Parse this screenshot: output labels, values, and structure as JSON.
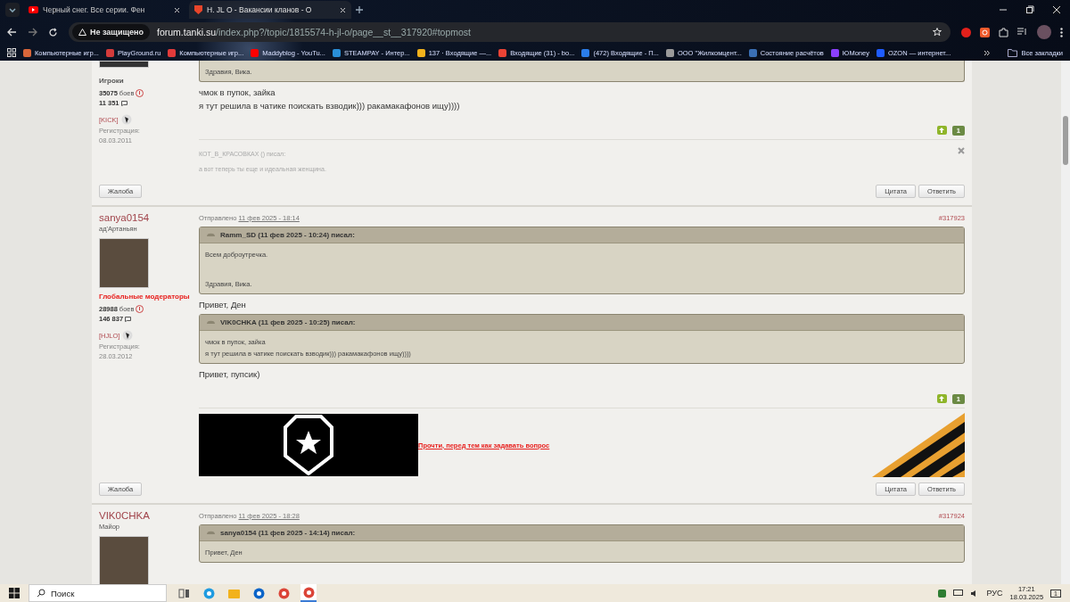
{
  "browser": {
    "tabs": [
      {
        "title": "Черный снег. Все серии. Фен",
        "selected": false,
        "kind": "video"
      },
      {
        "title": "H. JL O - Вакансии кланов - О",
        "selected": true,
        "kind": "shield"
      }
    ],
    "address": {
      "security": "Не защищено",
      "host": "forum.tanki.su",
      "path": "/index.php?/topic/1815574-h-jl-o/page__st__317920#topmost"
    },
    "bookmarks": [
      {
        "title": "Компьютерные игр...",
        "color": "#d9663a"
      },
      {
        "title": "PlayGround.ru",
        "color": "#d43b3b"
      },
      {
        "title": "Компьютерные игр...",
        "color": "#e23a3a"
      },
      {
        "title": "Maddyblog - YouTu...",
        "color": "#ff0000"
      },
      {
        "title": "STEAMPAY - Интер...",
        "color": "#2a8fd8"
      },
      {
        "title": "137 · Входящие —...",
        "color": "#f2b21c"
      },
      {
        "title": "Входящие (31) - bo...",
        "color": "#ea4335"
      },
      {
        "title": "(472) Входящие - П...",
        "color": "#2b7de9"
      },
      {
        "title": "ООО \"Жилкомцент...",
        "color": "#9a9a9a"
      },
      {
        "title": "Состояние расчётов",
        "color": "#3a6fb5"
      },
      {
        "title": "ЮMoney",
        "color": "#8b3ffd"
      },
      {
        "title": "OZON — интернет...",
        "color": "#1f5cff"
      }
    ],
    "all_bookmarks": "Все закладки"
  },
  "posts": [
    {
      "cut_top": true,
      "author": {
        "group": "Игроки",
        "highlighted": false,
        "battles": "35075",
        "battles_label": "боев",
        "messages": "11 351",
        "clan": "[KICK]",
        "reg_label": "Регистрация:",
        "reg_date": "08.03.2011"
      },
      "blocks": [
        {
          "kind": "quote",
          "paragraphs": [
            [
              "Здравия, Вика."
            ]
          ]
        },
        {
          "kind": "text",
          "lines": [
            "чмок в пупок, зайка",
            "я тут решила в чатике поискать взводик))) ракамакафонов ищу))))"
          ]
        }
      ],
      "vote_count": "1",
      "signature": {
        "kind": "quote_text",
        "author_line": "КОТ_В_КРАСОВКАХ () писал:",
        "text": "а вот теперь ты еще и идеальная женщина."
      },
      "buttons": {
        "report": "Жалоба",
        "quote": "Цитата",
        "reply": "Ответить"
      }
    },
    {
      "cut_top": false,
      "author": {
        "name": "sanya0154",
        "title": "ад'Артаньян",
        "group": "Глобальные модераторы",
        "highlighted": true,
        "battles": "28988",
        "battles_label": "боев",
        "messages": "146 837",
        "clan": "[HJLO]",
        "reg_label": "Регистрация:",
        "reg_date": "28.03.2012"
      },
      "posted_label": "Отправлено",
      "posted_date": "11 фев 2025 - 18:14",
      "post_number": "#317923",
      "blocks": [
        {
          "kind": "quote",
          "header": "Ramm_SD (11 фев 2025 - 10:24) писал:",
          "paragraphs": [
            [
              "Всем доброутречка."
            ],
            [
              "Здравия, Вика."
            ]
          ]
        },
        {
          "kind": "text",
          "lines": [
            "Привет, Ден"
          ]
        },
        {
          "kind": "quote",
          "header": "VIK0CHKA (11 фев 2025 - 10:25) писал:",
          "paragraphs": [
            [
              "чмок в пупок, зайка",
              "я тут решила в чатике поискать взводик))) ракамакафонов ищу))))"
            ]
          ]
        },
        {
          "kind": "text",
          "lines": [
            "Привет, пупсик)"
          ]
        }
      ],
      "vote_count": "1",
      "signature": {
        "kind": "banner",
        "link": "Прочти, перед тем как задавать вопрос"
      },
      "buttons": {
        "report": "Жалоба",
        "quote": "Цитата",
        "reply": "Ответить"
      }
    },
    {
      "cut_top": false,
      "author": {
        "name": "VIK0CHKA",
        "title": "Майор"
      },
      "posted_label": "Отправлено",
      "posted_date": "11 фев 2025 - 18:28",
      "post_number": "#317924",
      "blocks": [
        {
          "kind": "quote",
          "header": "sanya0154 (11 фев 2025 - 14:14) писал:",
          "paragraphs": [
            [
              "Привет, Ден"
            ]
          ]
        }
      ]
    }
  ],
  "taskbar": {
    "search": "Поиск",
    "apps": [
      {
        "kind": "task_view",
        "selected": false
      },
      {
        "kind": "edge",
        "selected": false
      },
      {
        "kind": "files",
        "selected": false
      },
      {
        "kind": "outlook",
        "selected": false
      },
      {
        "kind": "chrome",
        "selected": false
      },
      {
        "kind": "chrome",
        "selected": true
      }
    ],
    "lang": "РУС",
    "time": "17:21",
    "date": "18.03.2025",
    "notifications": "1"
  }
}
